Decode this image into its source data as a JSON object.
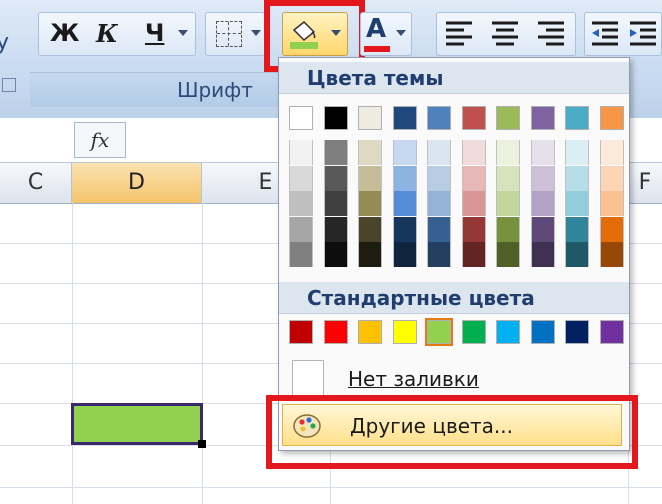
{
  "ribbon": {
    "bold_label": "Ж",
    "italic_label": "К",
    "underline_label": "Ч",
    "group_label": "Шрифт",
    "font_color_label": "А",
    "left_partial_label": "y"
  },
  "formula_bar": {
    "fx_label": "fx"
  },
  "columns": {
    "c": "C",
    "d": "D",
    "e": "E",
    "f": "F"
  },
  "fill_menu": {
    "theme_header": "Цвета темы",
    "standard_header": "Стандартные цвета",
    "no_fill_label": "Нет заливки",
    "more_colors_label": "Другие цвета...",
    "theme_colors": [
      "#ffffff",
      "#000000",
      "#eeece1",
      "#1f497d",
      "#4f81bd",
      "#c0504d",
      "#9bbb59",
      "#8064a2",
      "#4bacc6",
      "#f79646"
    ],
    "theme_shades": [
      [
        "#f2f2f2",
        "#d9d9d9",
        "#bfbfbf",
        "#a6a6a6",
        "#808080"
      ],
      [
        "#7f7f7f",
        "#595959",
        "#404040",
        "#262626",
        "#0d0d0d"
      ],
      [
        "#ddd9c3",
        "#c4bd97",
        "#948a54",
        "#4a452a",
        "#1e1c11"
      ],
      [
        "#c6d9f0",
        "#8db3e2",
        "#548dd4",
        "#17365d",
        "#0f243e"
      ],
      [
        "#dbe5f1",
        "#b8cce4",
        "#95b3d7",
        "#366092",
        "#244061"
      ],
      [
        "#f2dcdb",
        "#e6b9b8",
        "#d99694",
        "#953734",
        "#632423"
      ],
      [
        "#ebf1dd",
        "#d7e3bc",
        "#c3d69b",
        "#76923c",
        "#4f6128"
      ],
      [
        "#e5e0ec",
        "#ccc1d9",
        "#b2a2c7",
        "#5f497a",
        "#3f3151"
      ],
      [
        "#dbeef3",
        "#b7dde8",
        "#92cddc",
        "#31859b",
        "#205867"
      ],
      [
        "#fdeada",
        "#fbd5b5",
        "#fac08f",
        "#e36c09",
        "#974806"
      ]
    ],
    "standard_colors": [
      "#c00000",
      "#ff0000",
      "#ffc000",
      "#ffff00",
      "#92d050",
      "#00b050",
      "#00b0f0",
      "#0070c0",
      "#002060",
      "#7030a0"
    ],
    "selected_standard_index": 4
  },
  "colors": {
    "highlight_red": "#e3171c",
    "selected_cell_fill": "#92d050"
  }
}
